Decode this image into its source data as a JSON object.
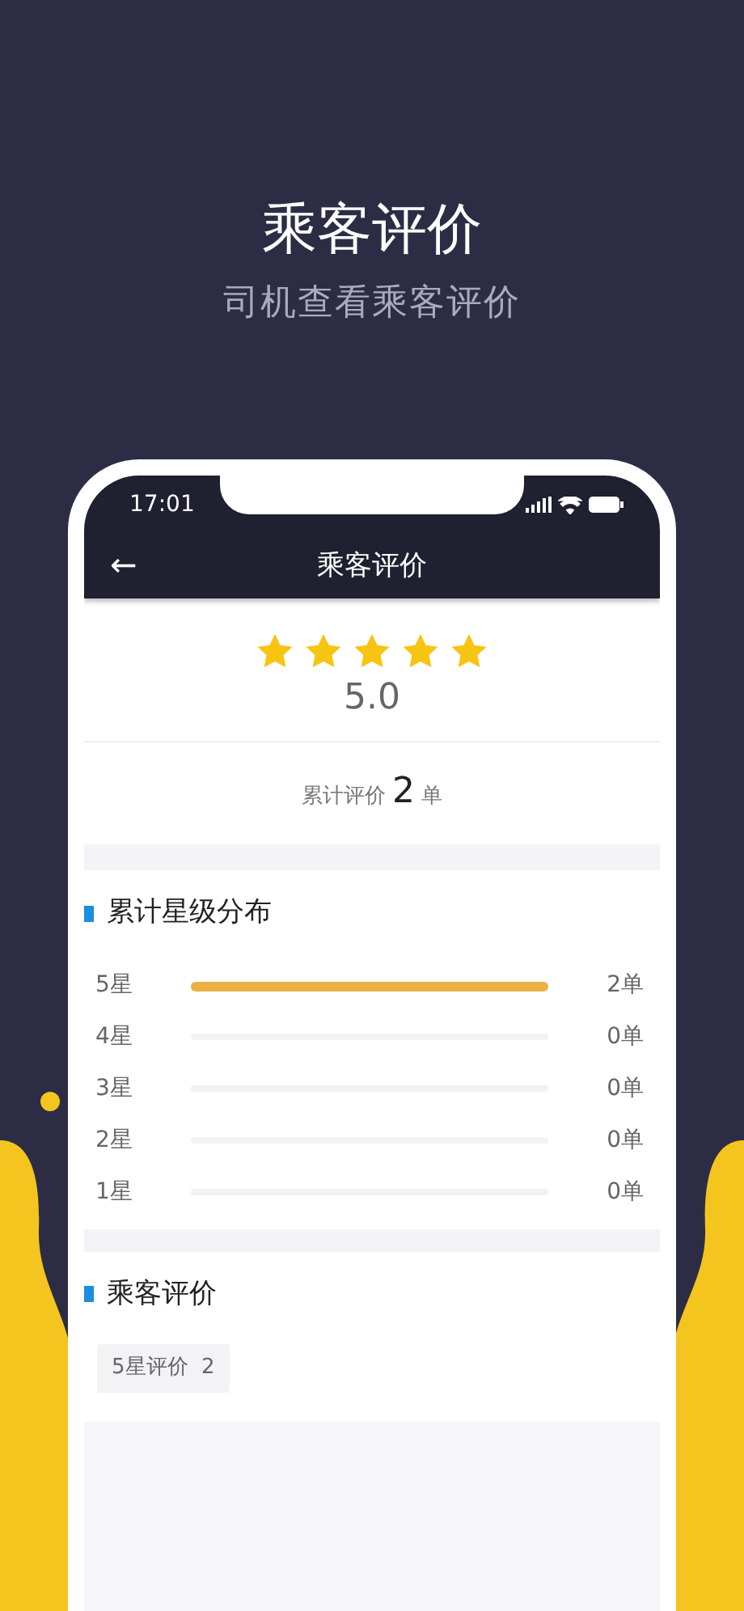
{
  "headline": "乘客评价",
  "subheadline": "司机查看乘客评价",
  "status_bar": {
    "time": "17:01"
  },
  "nav_bar": {
    "back": "←",
    "title": "乘客评价"
  },
  "rating": {
    "stars": 5,
    "score": "5.0",
    "total_label": "累计评价",
    "total_count": "2",
    "total_unit": "单"
  },
  "distribution": {
    "title": "累计星级分布",
    "rows": [
      {
        "label": "5星",
        "level": 1,
        "count": "2单"
      },
      {
        "label": "4星",
        "level": 0,
        "count": "0单"
      },
      {
        "label": "3星",
        "level": 0,
        "count": "0单"
      },
      {
        "label": "2星",
        "level": 0,
        "count": "0单"
      },
      {
        "label": "1星",
        "level": 0,
        "count": "0单"
      }
    ]
  },
  "reviews": {
    "title": "乘客评价",
    "filters": [
      {
        "label": "5星评价  2"
      }
    ]
  }
}
